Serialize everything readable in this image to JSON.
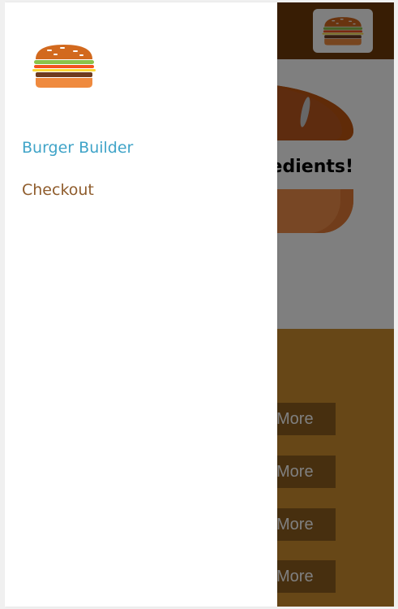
{
  "toolbar": {
    "logo": "burger-logo-icon"
  },
  "burger_preview": {
    "message": "Please start adding ingredients!"
  },
  "build_controls": {
    "more_buttons": [
      "More",
      "More",
      "More",
      "More"
    ]
  },
  "side_drawer": {
    "logo": "burger-logo-icon",
    "nav": [
      {
        "label": "Burger Builder",
        "active": true
      },
      {
        "label": "Checkout",
        "active": false
      }
    ]
  },
  "colors": {
    "toolbar": "#703b09",
    "active_link": "#40a4c8",
    "link": "#8f5c2c",
    "controls_bg": "#cf8f2e"
  }
}
